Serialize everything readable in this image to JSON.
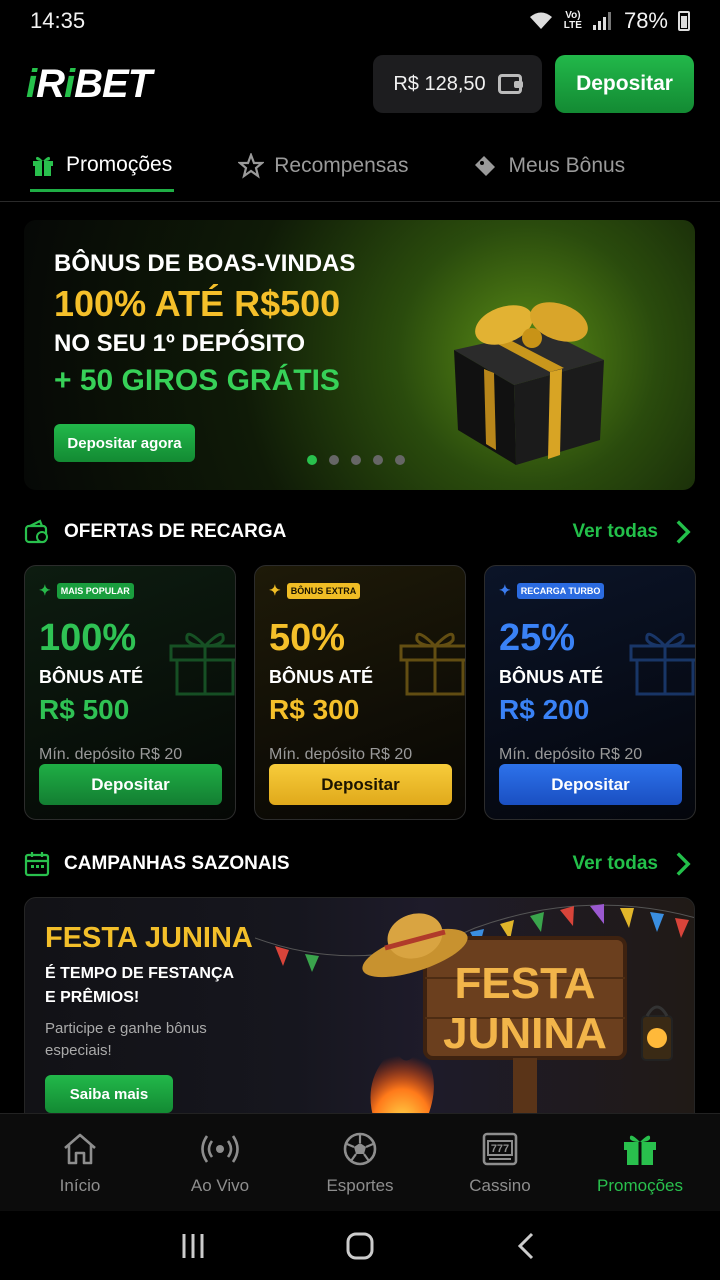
{
  "status": {
    "time": "14:35",
    "network": "Vo) LTE",
    "battery": "78%"
  },
  "header": {
    "logo": "iRiBET",
    "balance": "R$ 128,50",
    "deposit_label": "Depositar"
  },
  "tabs": [
    {
      "label": "Promoções",
      "icon": "gift-icon",
      "active": true
    },
    {
      "label": "Recompensas",
      "icon": "star-icon",
      "active": false
    },
    {
      "label": "Meus Bônus",
      "icon": "ticket-icon",
      "active": false
    }
  ],
  "hero": {
    "line1": "BÔNUS DE BOAS-VINDAS",
    "line2": "100% ATÉ R$500",
    "line3": "NO SEU 1º DEPÓSITO",
    "line4": "+ 50 GIROS GRÁTIS",
    "button": "Depositar agora",
    "slides": 5,
    "active_slide": 1
  },
  "recharge": {
    "title": "OFERTAS DE RECARGA",
    "see_all": "Ver todas",
    "cards": [
      {
        "badge": "MAIS POPULAR",
        "percent": "100%",
        "label": "BÔNUS ATÉ",
        "amount": "R$ 500",
        "min": "Mín. depósito R$ 20",
        "button": "Depositar",
        "color": "#2fc254"
      },
      {
        "badge": "BÔNUS EXTRA",
        "percent": "50%",
        "label": "BÔNUS ATÉ",
        "amount": "R$ 300",
        "min": "Mín. depósito R$ 20",
        "button": "Depositar",
        "color": "#f5c02a"
      },
      {
        "badge": "RECARGA TURBO",
        "percent": "25%",
        "label": "BÔNUS ATÉ",
        "amount": "R$ 200",
        "min": "Mín. depósito R$ 20",
        "button": "Depositar",
        "color": "#3a82f6"
      }
    ]
  },
  "seasonal": {
    "title": "CAMPANHAS SAZONAIS",
    "see_all": "Ver todas",
    "festa": {
      "title": "FESTA JUNINA",
      "subtitle_1": "É TEMPO DE FESTANÇA",
      "subtitle_2": "E PRÊMIOS!",
      "desc_1": "Participe e ganhe bônus",
      "desc_2": "especiais!",
      "button": "Saiba mais",
      "sign_1": "FESTA",
      "sign_2": "JUNINA"
    }
  },
  "bottom_nav": [
    {
      "label": "Início",
      "icon": "home-icon",
      "active": false
    },
    {
      "label": "Ao Vivo",
      "icon": "live-icon",
      "active": false
    },
    {
      "label": "Esportes",
      "icon": "soccer-ball-icon",
      "active": false
    },
    {
      "label": "Cassino",
      "icon": "slot-machine-icon",
      "active": false
    },
    {
      "label": "Promoções",
      "icon": "gift-icon",
      "active": true
    }
  ]
}
